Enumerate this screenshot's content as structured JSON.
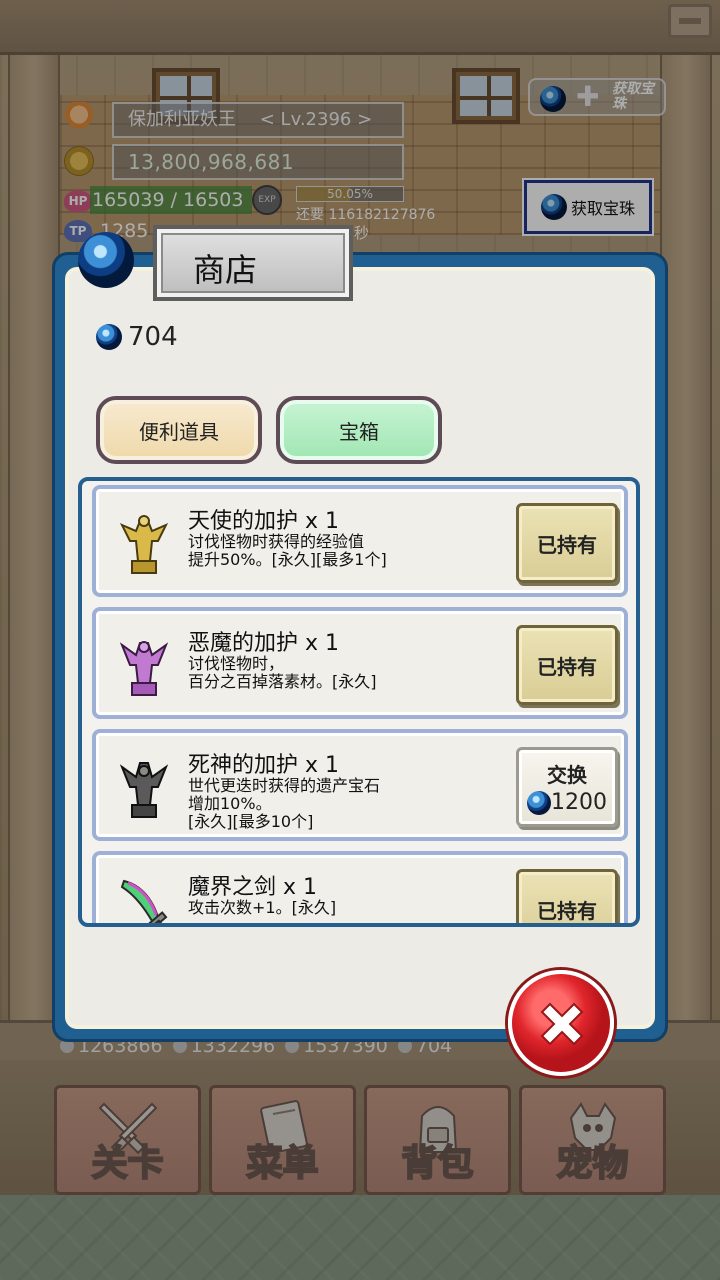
{
  "hud": {
    "player_name": "保加利亚妖王",
    "level": "< Lv.2396 >",
    "gold": "13,800,968,681",
    "hp_label": "HP",
    "hp": "165039 / 16503",
    "exp_label": "EXP",
    "exp_percent_text": "50.05%",
    "exp_fill": 0.5005,
    "exp_remaining": "还要 116182127876",
    "tp_label": "TP",
    "tp": "1285",
    "seconds": "秒",
    "gem_plus_label": "获取宝珠",
    "get_gem_button": "获取宝珠"
  },
  "shop": {
    "title": "商店",
    "gem_balance": "704",
    "tabs": [
      {
        "label": "便利道具"
      },
      {
        "label": "宝箱"
      }
    ],
    "items": [
      {
        "title": "天使的加护 x 1",
        "desc": [
          "讨伐怪物时获得的经验值",
          "提升50%。[永久][最多1个]"
        ],
        "button": "已持有",
        "icon": "angel-statue-icon"
      },
      {
        "title": "恶魔的加护 x 1",
        "desc": [
          "讨伐怪物时，",
          "百分之百掉落素材。[永久]"
        ],
        "button": "已持有",
        "icon": "demon-statue-icon"
      },
      {
        "title": "死神的加护 x 1",
        "desc": [
          "世代更迭时获得的遗产宝石",
          "增加10%。",
          "[永久][最多10个]"
        ],
        "button": "交换",
        "cost": "1200",
        "icon": "reaper-statue-icon"
      },
      {
        "title": "魔界之剑 x 1",
        "desc": [
          "攻击次数+1。[永久]"
        ],
        "button": "已持有",
        "icon": "demon-sword-icon"
      }
    ]
  },
  "bottom_stats": [
    "1263866",
    "1332296",
    "1537390",
    "704"
  ],
  "nav": [
    {
      "label": "关卡",
      "icon": "crossed-swords-icon"
    },
    {
      "label": "菜单",
      "icon": "book-icon"
    },
    {
      "label": "背包",
      "icon": "backpack-icon"
    },
    {
      "label": "宠物",
      "icon": "dragon-skull-icon"
    }
  ],
  "colors": {
    "modal_border": "#1f5f91",
    "tab_tools": "#efd9a9",
    "tab_chest": "#9fe6b2",
    "close_red": "#e0262c"
  }
}
